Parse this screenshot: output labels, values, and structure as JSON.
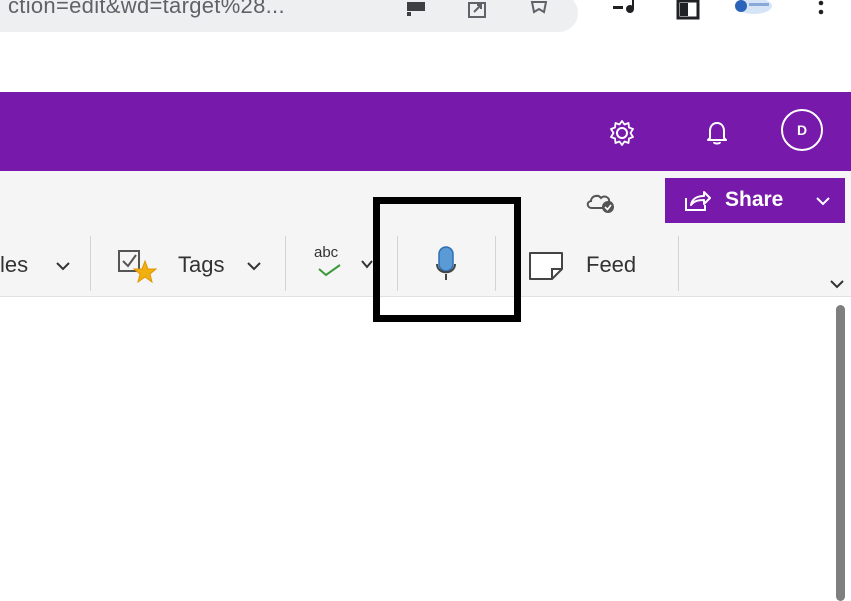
{
  "browser": {
    "url_fragment": "ction=edit&wd=target%28...",
    "icons": [
      "cast-icon",
      "share-page-icon",
      "bookmark-star-icon",
      "media-control-icon",
      "split-view-icon",
      "extension-icon",
      "kebab-menu-icon"
    ]
  },
  "header": {
    "background": "#7719aa",
    "avatar_initial": "D",
    "icons": [
      "settings-gear-icon",
      "notification-bell-icon"
    ]
  },
  "ribbon": {
    "styles_label_partial": "les",
    "tags_label": "Tags",
    "spelling_icon_text": "abc",
    "feed_label": "Feed",
    "share_label": "Share",
    "icons": [
      "cloud-sync-icon",
      "tag-icon",
      "spellcheck-icon",
      "microphone-dictate-icon",
      "feed-note-icon",
      "ribbon-collapse-chevron-icon"
    ]
  },
  "annotation": {
    "highlight_target": "dictate-microphone-button"
  }
}
